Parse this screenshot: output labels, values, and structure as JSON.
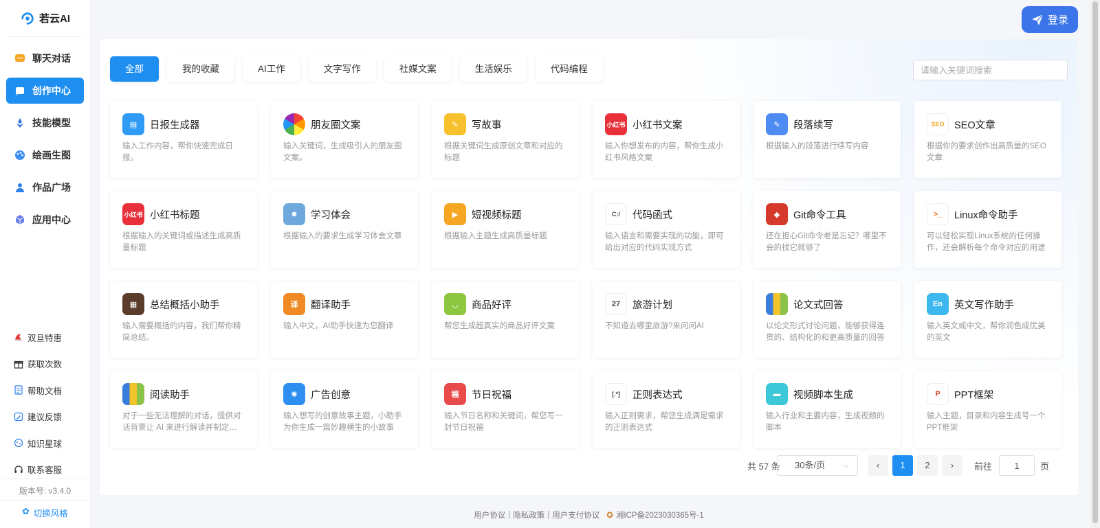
{
  "brand": {
    "name": "若云AI"
  },
  "nav": [
    {
      "label": "聊天对话",
      "icon": "chat-icon",
      "active": false
    },
    {
      "label": "创作中心",
      "icon": "creation-icon",
      "active": true
    },
    {
      "label": "技能模型",
      "icon": "skill-icon",
      "active": false
    },
    {
      "label": "绘画生图",
      "icon": "palette-icon",
      "active": false
    },
    {
      "label": "作品广场",
      "icon": "square-icon",
      "active": false
    },
    {
      "label": "应用中心",
      "icon": "cube-icon",
      "active": false
    }
  ],
  "bottom_links": [
    {
      "label": "双旦特惠",
      "icon": "hat-icon"
    },
    {
      "label": "获取次数",
      "icon": "gift-icon"
    },
    {
      "label": "帮助文档",
      "icon": "document-icon"
    },
    {
      "label": "建议反馈",
      "icon": "feedback-icon"
    },
    {
      "label": "知识星球",
      "icon": "planet-icon"
    },
    {
      "label": "联系客服",
      "icon": "headset-icon"
    }
  ],
  "version": "版本号: v3.4.0",
  "switch_style": "切换风格",
  "login": {
    "label": "登录"
  },
  "tabs": [
    "全部",
    "我的收藏",
    "AI工作",
    "文字写作",
    "社媒文案",
    "生活娱乐",
    "代码编程"
  ],
  "search": {
    "placeholder": "请输入关键词搜索"
  },
  "cards": [
    {
      "title": "日报生成器",
      "desc": "输入工作内容，帮你快速完成日报。",
      "icon": "calendar-icon",
      "color": "#2f9bf5",
      "glyph": "▤"
    },
    {
      "title": "朋友圈文案",
      "desc": "输入关键词，生成吸引人的朋友圈文案。",
      "icon": "aperture-icon",
      "color": "#ffffff",
      "glyph": ""
    },
    {
      "title": "写故事",
      "desc": "根据关键词生成原创文章和对应的标题",
      "icon": "notepad-icon",
      "color": "#f6c12c",
      "glyph": "✎"
    },
    {
      "title": "小红书文案",
      "desc": "输入你想发布的内容，帮你生成小红书风格文案",
      "icon": "xiaohongshu-icon",
      "color": "#e8303a",
      "glyph": "小红书"
    },
    {
      "title": "段落续写",
      "desc": "根据输入的段落进行续写内容",
      "icon": "paragraph-icon",
      "color": "#4e8cf3",
      "glyph": "✎"
    },
    {
      "title": "SEO文章",
      "desc": "根据你的要求创作出高质量的SEO文章",
      "icon": "seo-icon",
      "color": "#ffffff",
      "glyph": "SEO"
    },
    {
      "title": "小红书标题",
      "desc": "根据输入的关键词或描述生成高质量标题",
      "icon": "xiaohongshu-icon",
      "color": "#e8303a",
      "glyph": "小红书"
    },
    {
      "title": "学习体会",
      "desc": "根据输入的要求生成学习体会文章",
      "icon": "student-icon",
      "color": "#6fa8dc",
      "glyph": "☻"
    },
    {
      "title": "短视频标题",
      "desc": "根据输入主题生成高质量标题",
      "icon": "video-icon",
      "color": "#f5a623",
      "glyph": "▶"
    },
    {
      "title": "代码函式",
      "desc": "输入语言和需要实现的功能，即可给出对应的代码实现方式",
      "icon": "code-icon",
      "color": "#ffffff",
      "glyph": "C:/"
    },
    {
      "title": "Git命令工具",
      "desc": "还在担心Git命令老是忘记？哪里不会的找它就够了",
      "icon": "git-icon",
      "color": "#d63a2c",
      "glyph": "◆"
    },
    {
      "title": "Linux命令助手",
      "desc": "可以轻松实现Linux系统的任何操作，还会解析每个命令对应的用途",
      "icon": "terminal-icon",
      "color": "#ffffff",
      "glyph": ">_"
    },
    {
      "title": "总结概括小助手",
      "desc": "输入需要概括的内容，我们帮你精简总结。",
      "icon": "briefcase-icon",
      "color": "#5a3e2b",
      "glyph": "▦"
    },
    {
      "title": "翻译助手",
      "desc": "输入中文，AI助手快速为您翻译",
      "icon": "translate-icon",
      "color": "#f08a24",
      "glyph": "译"
    },
    {
      "title": "商品好评",
      "desc": "帮您生成超真实的商品好评文案",
      "icon": "shopping-bag-icon",
      "color": "#8dc63f",
      "glyph": "◡"
    },
    {
      "title": "旅游计划",
      "desc": "不知道去哪里旅游?来问问AI",
      "icon": "calendar-icon",
      "color": "#ffffff",
      "glyph": "27"
    },
    {
      "title": "论文式回答",
      "desc": "以论文形式讨论问题，能够获得连贯的、结构化的和更高质量的回答",
      "icon": "books-icon",
      "color": "#ffffff",
      "glyph": ""
    },
    {
      "title": "英文写作助手",
      "desc": "输入英文或中文，帮你润色成优美的英文",
      "icon": "english-icon",
      "color": "#3db8ef",
      "glyph": "En"
    },
    {
      "title": "阅读助手",
      "desc": "对于一些无法理解的对话，提供对话背景让 AI 来进行解读并制定出回复",
      "icon": "books-icon",
      "color": "#ffffff",
      "glyph": ""
    },
    {
      "title": "广告创意",
      "desc": "输入想写的创意故事主题，小助手为你生成一篇妙趣横生的小故事",
      "icon": "megaphone-icon",
      "color": "#2f8ff0",
      "glyph": "✺"
    },
    {
      "title": "节日祝福",
      "desc": "输入节日名称和关键词，帮您写一封节日祝福",
      "icon": "gift-card-icon",
      "color": "#e84b4b",
      "glyph": "福"
    },
    {
      "title": "正则表达式",
      "desc": "输入正则需求，帮您生成满足需求的正则表达式",
      "icon": "regex-icon",
      "color": "#ffffff",
      "glyph": "[.*]"
    },
    {
      "title": "视频脚本生成",
      "desc": "输入行业和主要内容，生成视频的脚本",
      "icon": "clapperboard-icon",
      "color": "#3cc8d8",
      "glyph": "▬"
    },
    {
      "title": "PPT框架",
      "desc": "输入主题，目录和内容生成号一个PPT框架",
      "icon": "ppt-icon",
      "color": "#ffffff",
      "glyph": "P"
    }
  ],
  "pagination": {
    "total": "共 57 条",
    "page_size": "30条/页",
    "pages": [
      "1",
      "2"
    ],
    "current": "1",
    "goto_label": "前往",
    "goto_value": "1",
    "goto_suffix": "页"
  },
  "footer": {
    "links": [
      "用户协议",
      "隐私政策",
      "用户支付协议"
    ],
    "icp": "湘ICP备2023030365号-1"
  }
}
